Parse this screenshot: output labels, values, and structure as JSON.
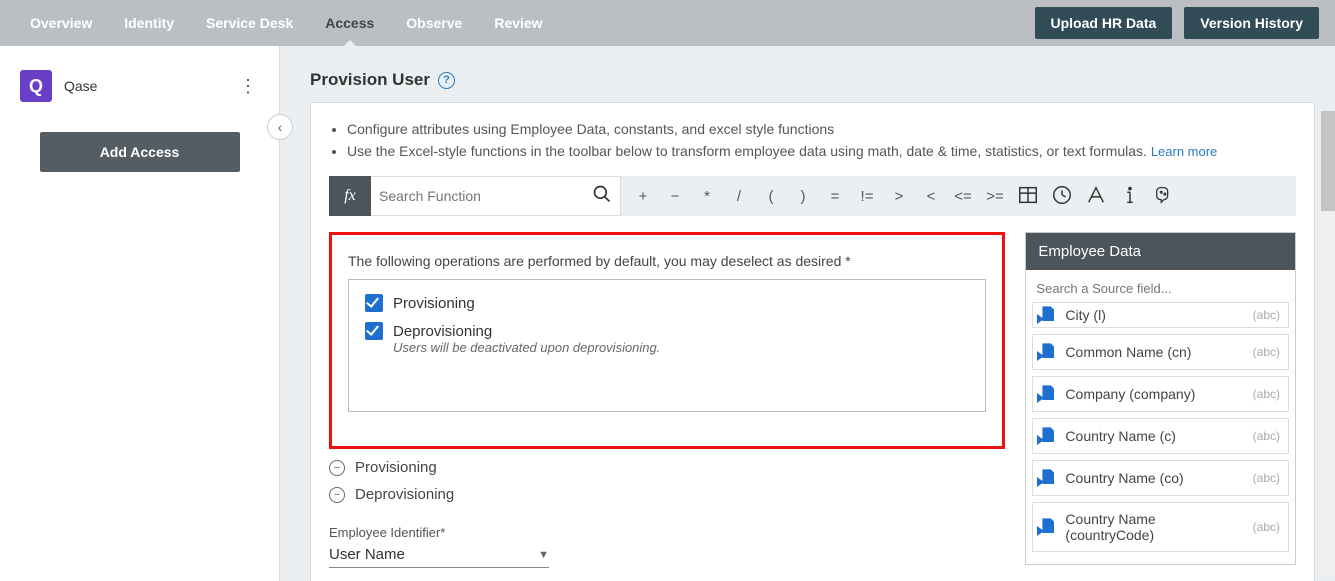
{
  "nav": {
    "tabs": [
      "Overview",
      "Identity",
      "Service Desk",
      "Access",
      "Observe",
      "Review"
    ],
    "active_index": 3,
    "upload_btn": "Upload HR Data",
    "version_btn": "Version History"
  },
  "sidebar": {
    "app_name": "Qase",
    "app_initial": "Q",
    "add_access_btn": "Add Access"
  },
  "page": {
    "title": "Provision User",
    "bullets": [
      "Configure attributes using Employee Data, constants, and excel style functions",
      "Use the Excel-style functions in the toolbar below to transform employee data using math, date & time, statistics, or text formulas."
    ],
    "learn_more": "Learn more"
  },
  "fx": {
    "label": "fx",
    "search_placeholder": "Search Function",
    "ops": [
      "+",
      "−",
      "*",
      "/",
      "(",
      ")",
      "=",
      "!=",
      ">",
      "<",
      "<=",
      ">="
    ]
  },
  "operations": {
    "header": "The following operations are performed by default, you may deselect as desired *",
    "items": [
      {
        "label": "Provisioning",
        "checked": true,
        "note": null
      },
      {
        "label": "Deprovisioning",
        "checked": true,
        "note": "Users will be deactivated upon deprovisioning."
      }
    ],
    "collapse": [
      "Provisioning",
      "Deprovisioning"
    ]
  },
  "identifier": {
    "label": "Employee Identifier*",
    "value": "User Name"
  },
  "emp_panel": {
    "title": "Employee Data",
    "search_placeholder": "Search a Source field...",
    "fields": [
      {
        "label": "City (l)",
        "type": "(abc)"
      },
      {
        "label": "Common Name (cn)",
        "type": "(abc)"
      },
      {
        "label": "Company (company)",
        "type": "(abc)"
      },
      {
        "label": "Country Name (c)",
        "type": "(abc)"
      },
      {
        "label": "Country Name (co)",
        "type": "(abc)"
      },
      {
        "label": "Country Name (countryCode)",
        "type": "(abc)"
      }
    ]
  }
}
